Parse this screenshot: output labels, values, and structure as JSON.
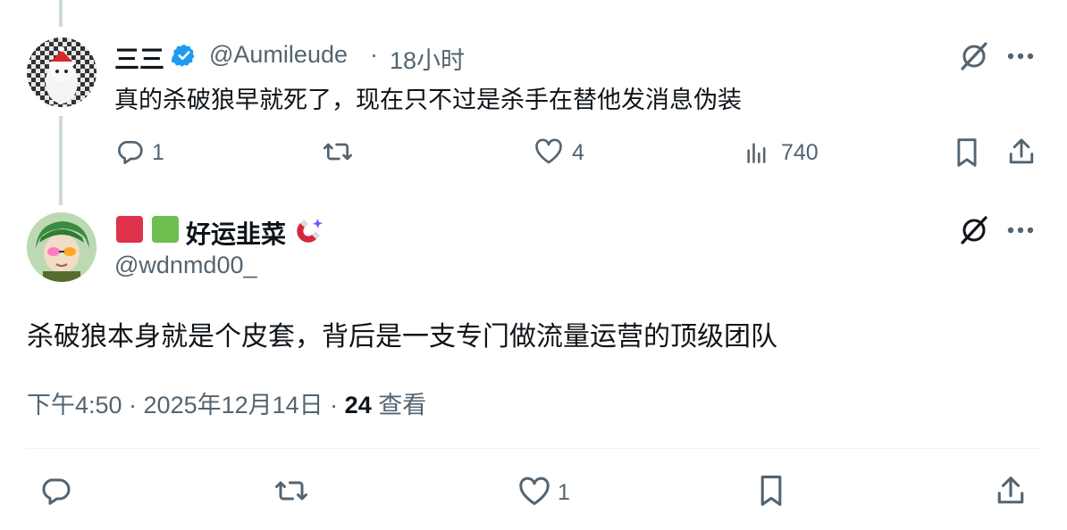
{
  "colors": {
    "text": "#0f1419",
    "muted": "#536471",
    "verified_blue": "#1d9bf0",
    "divider": "#eff3f4",
    "thread_line": "#cfd9de"
  },
  "parent_post": {
    "display_name": "三三",
    "handle": "@Aumileude",
    "separator": "·",
    "time": "18小时",
    "text": "真的杀破狼早就死了，现在只不过是杀手在替他发消息伪装",
    "actions": {
      "reply_count": "1",
      "repost_count": "",
      "like_count": "4",
      "view_count": "740"
    },
    "icons": [
      "verified-badge-icon",
      "grok-icon",
      "more-icon",
      "reply-icon",
      "repost-icon",
      "like-icon",
      "views-icon",
      "bookmark-icon",
      "share-icon"
    ]
  },
  "main_post": {
    "display_name": "好运韭菜",
    "handle": "@wdnmd00_",
    "text": "杀破狼本身就是个皮套，背后是一支专门做流量运营的顶级团队",
    "timestamp": "下午4:50 · 2025年12月14日 · ",
    "views_count": "24",
    "views_label": " 查看",
    "actions": {
      "reply_count": "",
      "repost_count": "",
      "like_count": "1"
    },
    "icons": [
      "red-square-icon",
      "green-square-icon",
      "magnet-icon",
      "grok-icon",
      "more-icon",
      "reply-icon",
      "repost-icon",
      "like-icon",
      "bookmark-icon",
      "share-icon"
    ]
  }
}
